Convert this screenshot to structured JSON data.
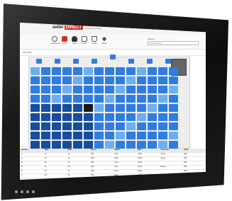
{
  "header": {
    "brand_text": "seller",
    "brand_mark": "DIRECT",
    "brand_sub": "Software Concept",
    "links": [
      "Welcome",
      "Help",
      "My Account",
      "Logout"
    ]
  },
  "toolbar": {
    "tools": [
      {
        "label": "Dashboard",
        "icon": "clock-icon",
        "color": "#555555"
      },
      {
        "label": "Events",
        "icon": "calendar-icon",
        "color": "#d62d20"
      },
      {
        "label": "Seats",
        "icon": "people-icon",
        "color": "#333333"
      },
      {
        "label": "Reports",
        "icon": "report-icon",
        "color": "#555555"
      },
      {
        "label": "Orders",
        "icon": "cart-icon",
        "color": "#555555"
      },
      {
        "label": "Admin",
        "icon": "wrench-icon",
        "color": "#555555"
      }
    ],
    "search_label": "Search",
    "search_value": "Event Name"
  },
  "subbar": {
    "title": "Seat Map"
  },
  "map": {
    "columns": 14,
    "rows": 9,
    "selected_cell": [
      4,
      5
    ],
    "colors": {
      "available": "#2f7de0",
      "light": "#6eaef2",
      "dark": "#174e9c",
      "selected": "#1a1a1a"
    }
  },
  "table": {
    "headers": [
      "Section",
      "Row",
      "Seat",
      "Price",
      "Status",
      "Date",
      "Customer",
      "Total"
    ],
    "rows": [
      [
        "A",
        "01",
        "12",
        "$45",
        "Sold",
        "12/01",
        "Smith",
        "$45"
      ],
      [
        "A",
        "01",
        "13",
        "$45",
        "Held",
        "12/01",
        "Jones",
        "$45"
      ],
      [
        "B",
        "02",
        "07",
        "$60",
        "Open",
        "12/02",
        "",
        "$60"
      ],
      [
        "B",
        "02",
        "08",
        "$60",
        "Sold",
        "12/02",
        "Brown",
        "$60"
      ],
      [
        "C",
        "03",
        "15",
        "$30",
        "Open",
        "12/03",
        "",
        "$30"
      ],
      [
        "C",
        "03",
        "16",
        "$30",
        "Sold",
        "12/03",
        "Davis",
        "$30"
      ]
    ]
  }
}
